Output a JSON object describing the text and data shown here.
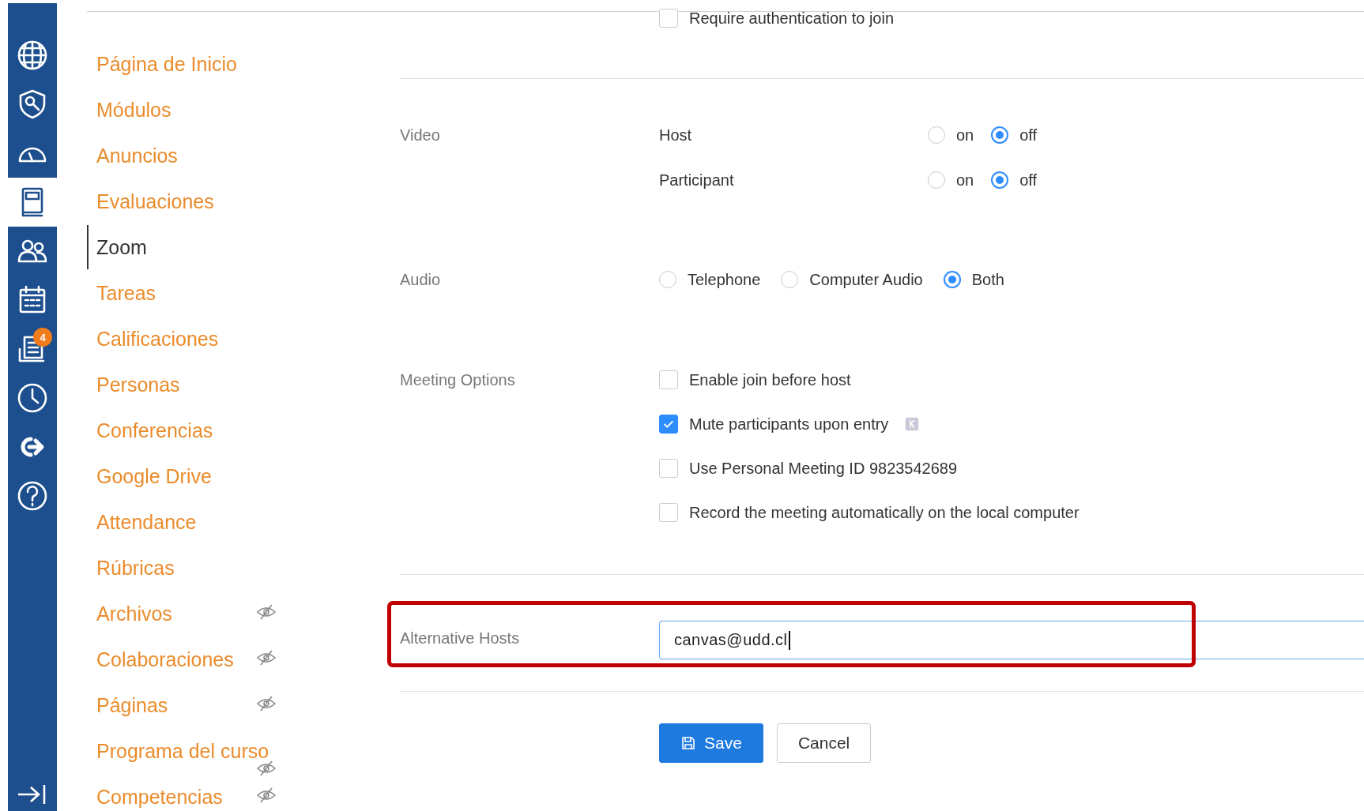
{
  "rail": {
    "items": [
      {
        "kind": "globe",
        "selected": false
      },
      {
        "kind": "shield",
        "selected": false
      },
      {
        "kind": "gauge",
        "selected": false
      },
      {
        "kind": "book",
        "selected": true
      },
      {
        "kind": "people",
        "selected": false
      },
      {
        "kind": "calendar",
        "selected": false
      },
      {
        "kind": "inbox",
        "selected": false,
        "badge": "4"
      },
      {
        "kind": "clock",
        "selected": false
      },
      {
        "kind": "arrow",
        "selected": false
      },
      {
        "kind": "help",
        "selected": false
      }
    ]
  },
  "nav": {
    "items": [
      {
        "label": "Página de Inicio",
        "selected": false,
        "hidden": false
      },
      {
        "label": "Módulos",
        "selected": false,
        "hidden": false
      },
      {
        "label": "Anuncios",
        "selected": false,
        "hidden": false
      },
      {
        "label": "Evaluaciones",
        "selected": false,
        "hidden": false
      },
      {
        "label": "Zoom",
        "selected": true,
        "hidden": false
      },
      {
        "label": "Tareas",
        "selected": false,
        "hidden": false
      },
      {
        "label": "Calificaciones",
        "selected": false,
        "hidden": false
      },
      {
        "label": "Personas",
        "selected": false,
        "hidden": false
      },
      {
        "label": "Conferencias",
        "selected": false,
        "hidden": false
      },
      {
        "label": "Google Drive",
        "selected": false,
        "hidden": false
      },
      {
        "label": "Attendance",
        "selected": false,
        "hidden": false
      },
      {
        "label": "Rúbricas",
        "selected": false,
        "hidden": false
      },
      {
        "label": "Archivos",
        "selected": false,
        "hidden": true
      },
      {
        "label": "Colaboraciones",
        "selected": false,
        "hidden": true
      },
      {
        "label": "Páginas",
        "selected": false,
        "hidden": true
      },
      {
        "label": "Programa del curso",
        "selected": false,
        "hidden": true
      },
      {
        "label": "Competencias",
        "selected": false,
        "hidden": true
      }
    ]
  },
  "form": {
    "top_option": {
      "label": "Require authentication to join",
      "checked": false
    },
    "video": {
      "label": "Video",
      "rows": [
        {
          "label": "Host",
          "options": [
            {
              "label": "on",
              "selected": false
            },
            {
              "label": "off",
              "selected": true
            }
          ]
        },
        {
          "label": "Participant",
          "options": [
            {
              "label": "on",
              "selected": false
            },
            {
              "label": "off",
              "selected": true
            }
          ]
        }
      ]
    },
    "audio": {
      "label": "Audio",
      "options": [
        {
          "label": "Telephone",
          "selected": false
        },
        {
          "label": "Computer Audio",
          "selected": false
        },
        {
          "label": "Both",
          "selected": true
        }
      ]
    },
    "meeting_options": {
      "label": "Meeting Options",
      "options": [
        {
          "label": "Enable join before host",
          "checked": false,
          "info": false
        },
        {
          "label": "Mute participants upon entry",
          "checked": true,
          "info": true
        },
        {
          "label": "Use Personal Meeting ID 9823542689",
          "checked": false,
          "info": false
        },
        {
          "label": "Record the meeting automatically on the local computer",
          "checked": false,
          "info": false
        }
      ]
    },
    "alternative_hosts": {
      "label": "Alternative Hosts",
      "value": "canvas@udd.cl",
      "highlighted": true
    },
    "buttons": [
      {
        "label": "Save",
        "kind": "primary"
      },
      {
        "label": "Cancel",
        "kind": "secondary"
      }
    ]
  }
}
